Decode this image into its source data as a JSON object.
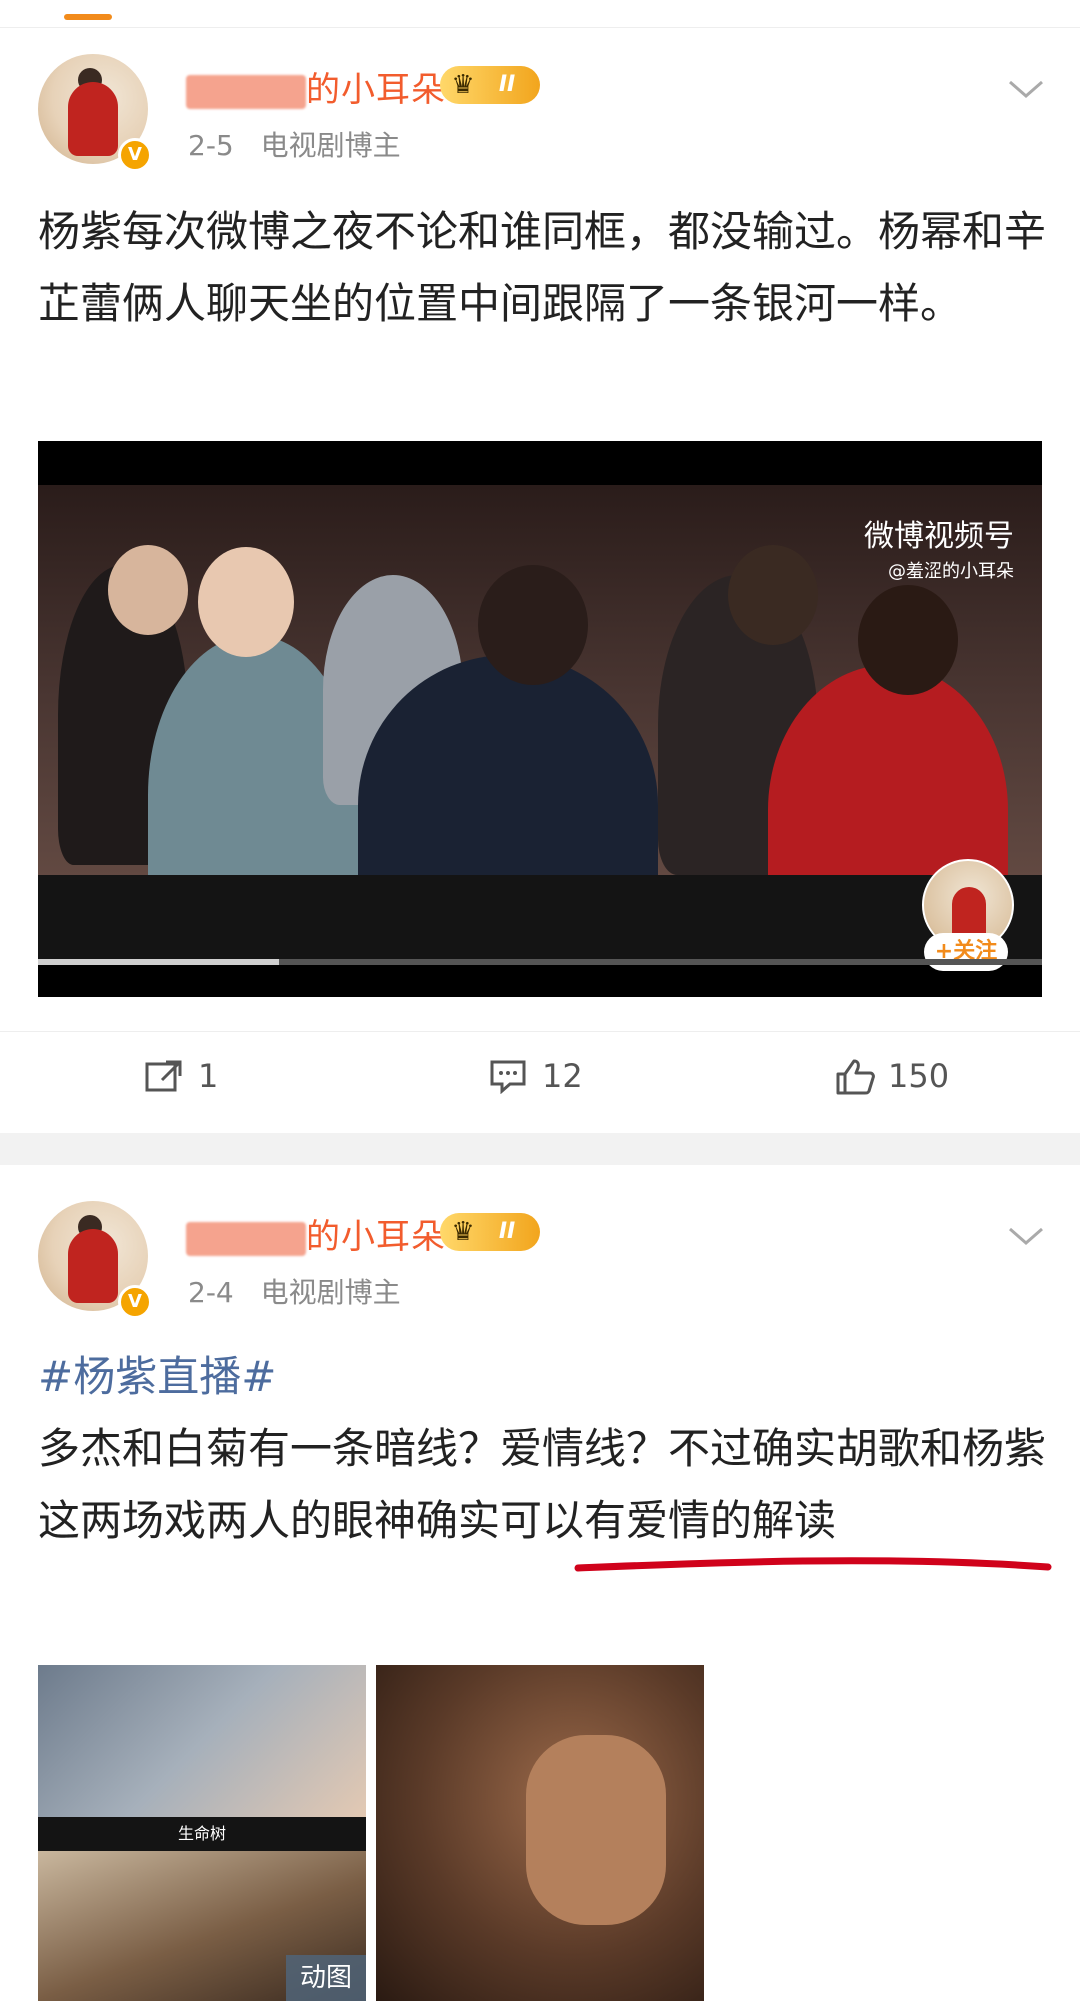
{
  "post1": {
    "username": "的小耳朵",
    "level_badge": "II",
    "date": "2-5",
    "source": "电视剧博主",
    "text": "杨紫每次微博之夜不论和谁同框，都没输过。杨幂和辛芷蕾俩人聊天坐的位置中间跟隔了一条银河一样。",
    "video": {
      "watermark": "微博视频号",
      "watermark_sub": "@羞涩的小耳朵",
      "follow_label": "+关注",
      "progress": 0.24
    },
    "actions": {
      "repost_count": "1",
      "comment_count": "12",
      "like_count": "150"
    }
  },
  "post2": {
    "username": "的小耳朵",
    "level_badge": "II",
    "date": "2-4",
    "source": "电视剧博主",
    "hashtag": "#杨紫直播#",
    "text": "多杰和白菊有一条暗线？爱情线？不过确实胡歌和杨紫这两场戏两人的眼神确实可以有爱情的解读",
    "image1_caption": "生命树",
    "gif_label": "动图"
  },
  "colors": {
    "accent": "#f28b1b",
    "hashtag": "#4d6c9e",
    "underline": "#d0021b"
  }
}
